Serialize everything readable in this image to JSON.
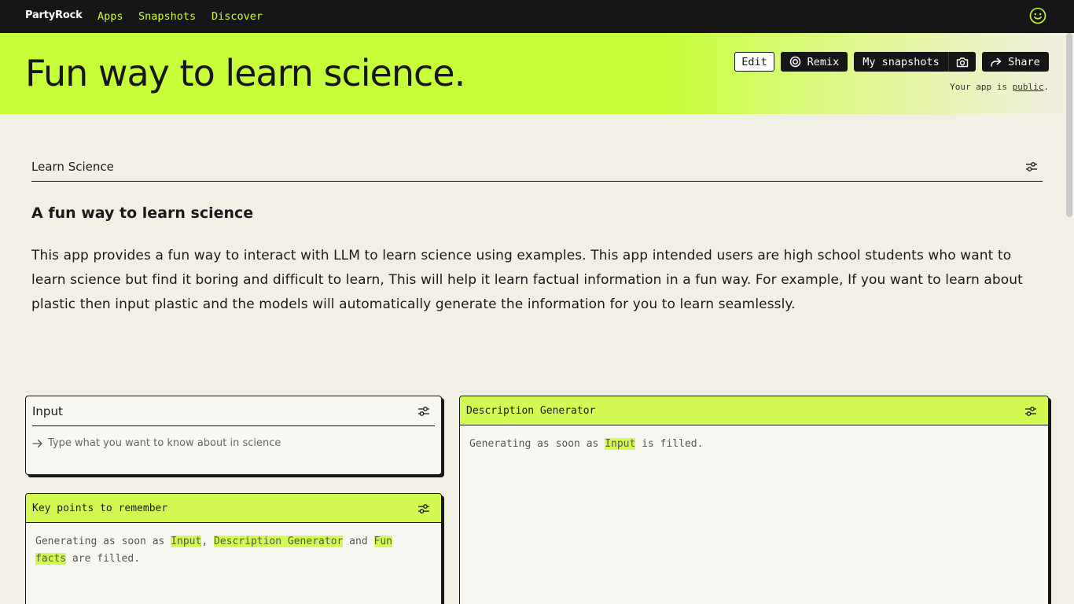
{
  "nav": {
    "brand": "PartyRock",
    "links": [
      "Apps",
      "Snapshots",
      "Discover"
    ],
    "profile_icon": "smiley-icon",
    "accent": "#c6ff3a"
  },
  "hero": {
    "title": "Fun way to learn science.",
    "buttons": {
      "edit": "Edit",
      "remix": "Remix",
      "snapshots": "My snapshots",
      "share": "Share"
    },
    "visibility_prefix": "Your app is ",
    "visibility_link": "public",
    "visibility_suffix": "."
  },
  "section": {
    "title": "Learn Science"
  },
  "description": {
    "heading": "A fun way to learn science",
    "text": "This app provides a fun way to interact with LLM to learn science using examples. This app intended users are high school students who want to learn science but find it boring and difficult to learn, This will help it learn factual information in a fun way. For example, If you want to learn about plastic then input plastic and the models will automatically generate the information for you to learn seamlessly."
  },
  "widgets": {
    "input": {
      "title": "Input",
      "placeholder": "Type what you want to know about in science"
    },
    "key_points": {
      "title": "Key points to remember",
      "prefix": "Generating as soon as ",
      "dep1": "Input",
      "sep1": ", ",
      "dep2": "Description Generator",
      "sep2": " and ",
      "dep3": "Fun facts",
      "suffix": " are filled."
    },
    "description_generator": {
      "title": "Description Generator",
      "prefix": "Generating as soon as ",
      "dep1": "Input",
      "suffix": " is filled."
    }
  }
}
